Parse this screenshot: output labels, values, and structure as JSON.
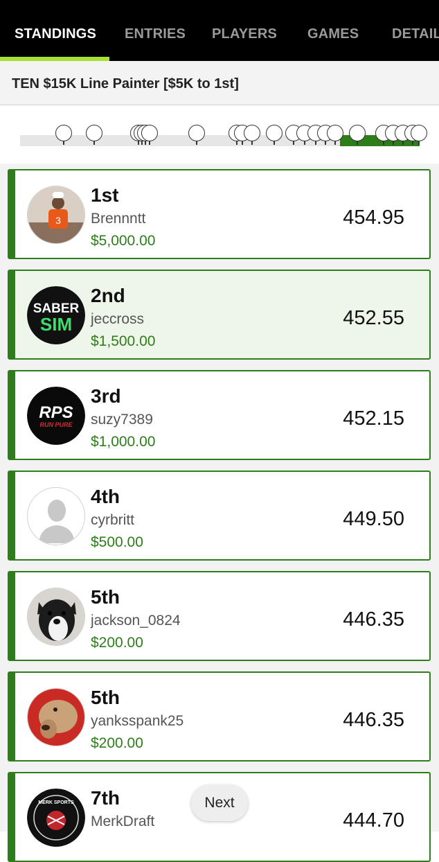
{
  "tabs": [
    {
      "label": "STANDINGS",
      "active": true
    },
    {
      "label": "ENTRIES",
      "active": false
    },
    {
      "label": "PLAYERS",
      "active": false
    },
    {
      "label": "GAMES",
      "active": false
    },
    {
      "label": "DETAIL",
      "active": false
    }
  ],
  "contest": {
    "title": "TEN $15K Line Painter [$5K to 1st]"
  },
  "progress": {
    "filled_fraction": 0.2
  },
  "standings": [
    {
      "rank": "1st",
      "username": "Brennntt",
      "prize": "$5,000.00",
      "score": "454.95",
      "avatar": "photo-person-icon",
      "highlight": false
    },
    {
      "rank": "2nd",
      "username": "jeccross",
      "prize": "$1,500.00",
      "score": "452.55",
      "avatar": "sabersim-logo",
      "highlight": true,
      "avatar_text_top": "SABER",
      "avatar_text_bottom": "SIM"
    },
    {
      "rank": "3rd",
      "username": "suzy7389",
      "prize": "$1,000.00",
      "score": "452.15",
      "avatar": "rps-logo",
      "highlight": false,
      "avatar_text_top": "RPS",
      "avatar_text_bottom": "RUN PURE"
    },
    {
      "rank": "4th",
      "username": "cyrbritt",
      "prize": "$500.00",
      "score": "449.50",
      "avatar": "default-avatar-icon",
      "highlight": false
    },
    {
      "rank": "5th",
      "username": "jackson_0824",
      "prize": "$200.00",
      "score": "446.35",
      "avatar": "dog-photo-icon",
      "highlight": false
    },
    {
      "rank": "5th",
      "username": "yanksspank25",
      "prize": "$200.00",
      "score": "446.35",
      "avatar": "dog-photo-icon",
      "highlight": false
    },
    {
      "rank": "7th",
      "username": "MerkDraft",
      "prize": "",
      "score": "444.70",
      "avatar": "merk-sports-logo",
      "highlight": false,
      "avatar_text_top": "MERK SPORTS"
    }
  ],
  "next_button": {
    "label": "Next"
  },
  "colors": {
    "accent_green": "#2d7d1a",
    "tab_indicator": "#a6e22e",
    "tabbar_bg": "#000000"
  }
}
